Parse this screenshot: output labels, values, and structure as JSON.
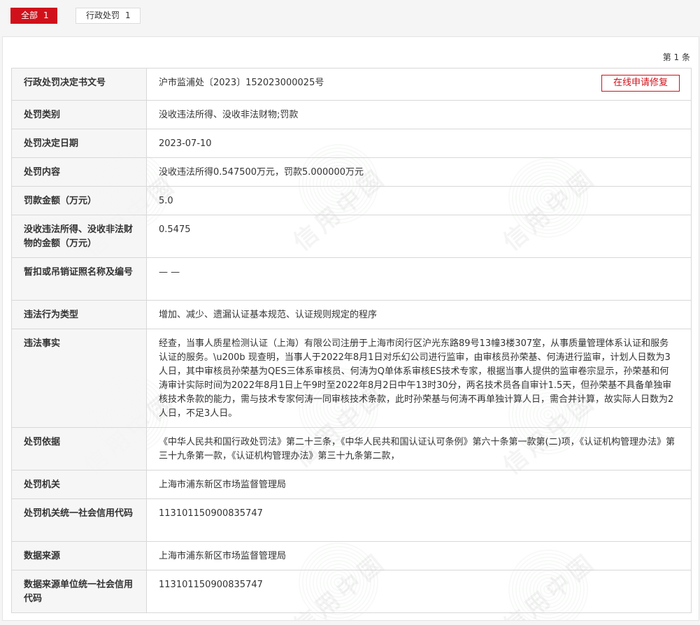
{
  "tabs": [
    {
      "label": "全部",
      "count": "1"
    },
    {
      "label": "行政处罚",
      "count": "1"
    }
  ],
  "page_count": "第 1 条",
  "repair_button": "在线申请修复",
  "watermark_text": "信用中国",
  "rows": [
    {
      "label": "行政处罚决定书文号",
      "value": "沪市监浦处〔2023〕152023000025号"
    },
    {
      "label": "处罚类别",
      "value": "没收违法所得、没收非法财物;罚款"
    },
    {
      "label": "处罚决定日期",
      "value": "2023-07-10"
    },
    {
      "label": "处罚内容",
      "value": "没收违法所得0.547500万元，罚款5.000000万元"
    },
    {
      "label": "罚款金额（万元）",
      "value": "5.0"
    },
    {
      "label": "没收违法所得、没收非法财物的金额（万元）",
      "value": "0.5475"
    },
    {
      "label": "暂扣或吊销证照名称及编号",
      "value": "— —"
    },
    {
      "label": "违法行为类型",
      "value": "增加、减少、遗漏认证基本规范、认证规则规定的程序"
    },
    {
      "label": "违法事实",
      "value": "经查，当事人质星检测认证（上海）有限公司注册于上海市闵行区沪光东路89号13幢3楼307室，从事质量管理体系认证和服务认证的服务。\\u200b 现查明，当事人于2022年8月1日对乐幻公司进行监审，由审核员孙荣基、何涛进行监审，计划人日数为3人日，其中审核员孙荣基为QES三体系审核员、何涛为Q单体系审核ES技术专家，根据当事人提供的监审卷宗显示，孙荣基和何涛审计实际时间为2022年8月1日上午9时至2022年8月2日中午13时30分，两名技术员各自审计1.5天，但孙荣基不具备单独审核技术条款的能力，需与技术专家何涛一同审核技术条款，此时孙荣基与何涛不再单独计算人日，需合并计算，故实际人日数为2人日，不足3人日。"
    },
    {
      "label": "处罚依据",
      "value": "《中华人民共和国行政处罚法》第二十三条，《中华人民共和国认证认可条例》第六十条第一款第(二)项，《认证机构管理办法》第三十九条第一款，《认证机构管理办法》第三十九条第二款，"
    },
    {
      "label": "处罚机关",
      "value": "上海市浦东新区市场监督管理局"
    },
    {
      "label": "处罚机关统一社会信用代码",
      "value": "11310115090083574​7"
    },
    {
      "label": "数据来源",
      "value": "上海市浦东新区市场监督管理局"
    },
    {
      "label": "数据来源单位统一社会信用代码",
      "value": "113101150900835747"
    }
  ]
}
